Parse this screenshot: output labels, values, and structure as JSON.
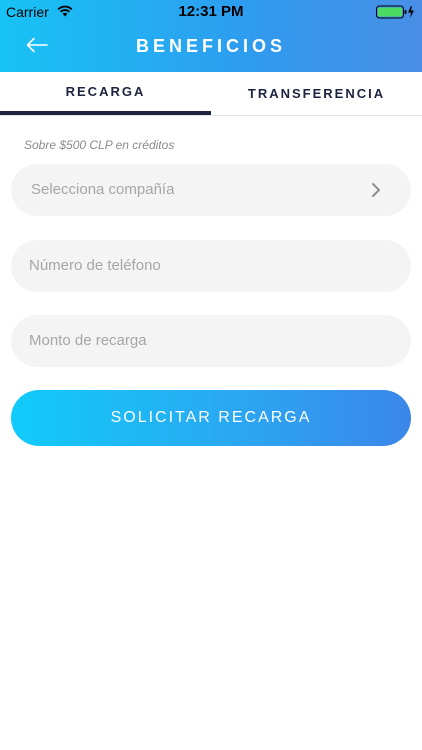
{
  "status_bar": {
    "carrier": "Carrier",
    "time": "12:31 PM"
  },
  "header": {
    "title": "BENEFICIOS",
    "back_icon": "arrow-left-icon"
  },
  "tabs": [
    {
      "label": "RECARGA",
      "active": true
    },
    {
      "label": "TRANSFERENCIA",
      "active": false
    }
  ],
  "form": {
    "note": "Sobre $500 CLP en créditos",
    "company_placeholder": "Selecciona compañía",
    "phone_placeholder": "Número de teléfono",
    "amount_placeholder": "Monto de recarga",
    "submit_label": "SOLICITAR RECARGA"
  },
  "colors": {
    "header_start": "#17c3f5",
    "header_end": "#4a8ee6",
    "tab_active": "#1c2440",
    "button_start": "#11cbfb",
    "button_end": "#3b86ea",
    "battery": "#4cd964"
  }
}
